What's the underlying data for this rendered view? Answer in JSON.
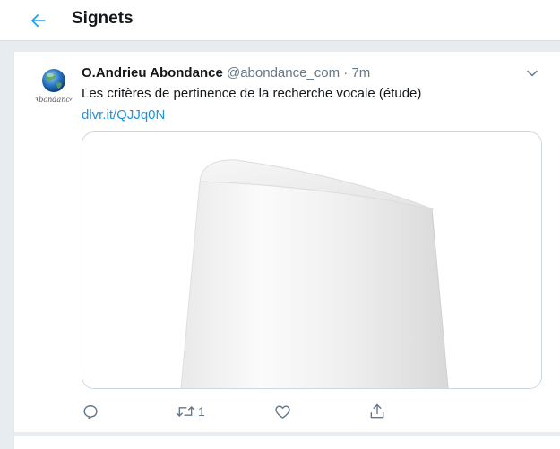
{
  "header": {
    "title": "Signets",
    "back_icon": "arrow-left-icon"
  },
  "colors": {
    "accent": "#1da1f2",
    "link": "#1b95e0",
    "secondary_text": "#657786",
    "background": "#e6ecf0"
  },
  "tweet": {
    "avatar_caption": "Abondance",
    "display_name": "O.Andrieu Abondance",
    "handle": "@abondance_com",
    "separator": "·",
    "time": "7m",
    "text": "Les critères de pertinence de la recherche vocale (étude)",
    "link": "dlvr.it/QJJq0N",
    "actions": {
      "reply": {
        "icon": "reply-icon"
      },
      "retweet": {
        "icon": "retweet-icon",
        "count": "1"
      },
      "like": {
        "icon": "heart-icon"
      },
      "share": {
        "icon": "share-icon"
      }
    }
  }
}
